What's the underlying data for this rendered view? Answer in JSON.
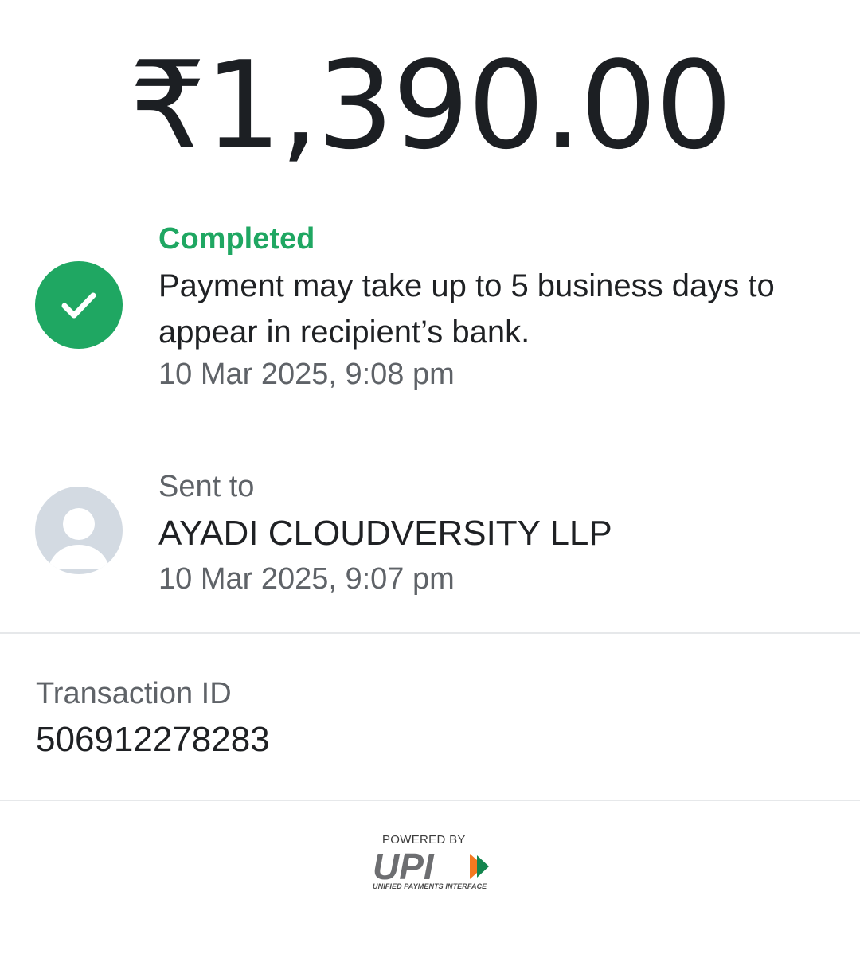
{
  "payment": {
    "amount": "₹1,390.00"
  },
  "status": {
    "label": "Completed",
    "message": "Payment may take up to 5 business days to appear in recipient’s bank.",
    "timestamp": "10 Mar 2025, 9:08 pm",
    "icon": "check-circle-icon",
    "color": "#1fa762"
  },
  "recipient": {
    "label": "Sent to",
    "name": "AYADI CLOUDVERSITY LLP",
    "timestamp": "10 Mar 2025, 9:07 pm",
    "icon": "avatar-placeholder-icon"
  },
  "transaction": {
    "label": "Transaction ID",
    "id": "506912278283"
  },
  "footer": {
    "powered_by": "POWERED BY",
    "brand": "UPI",
    "brand_subtitle": "UNIFIED PAYMENTS INTERFACE"
  }
}
